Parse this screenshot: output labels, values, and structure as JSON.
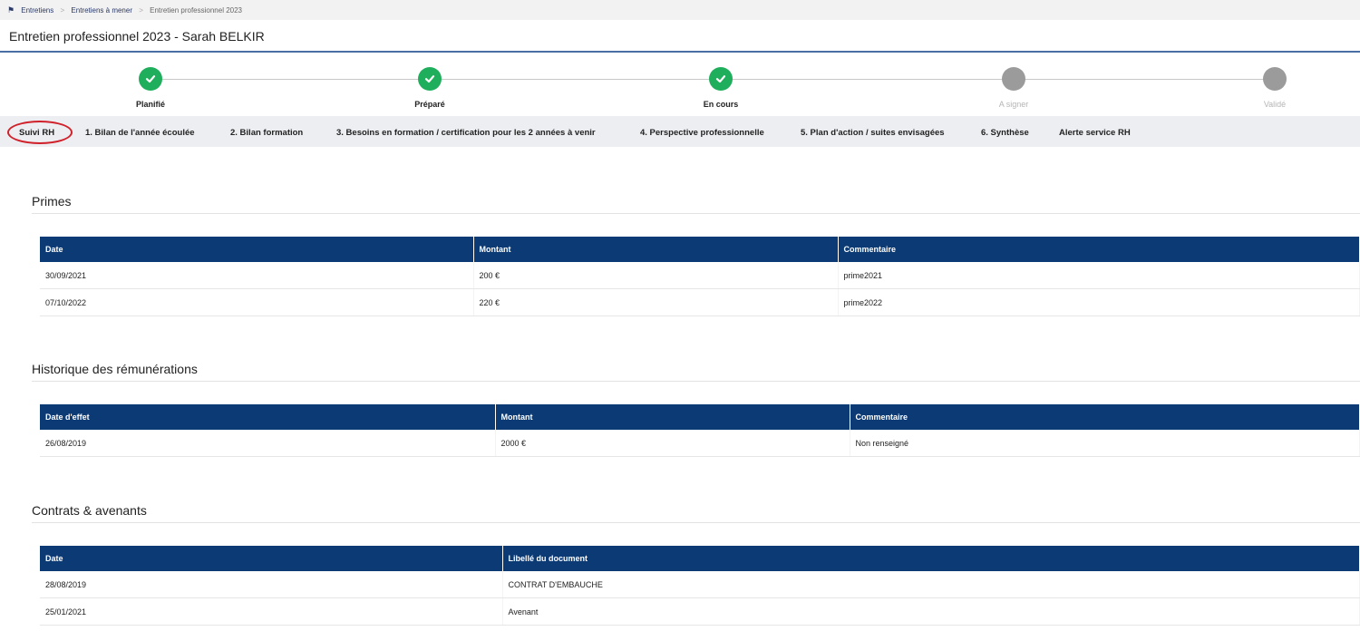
{
  "breadcrumb": {
    "items": [
      "Entretiens",
      "Entretiens à mener",
      "Entretien professionnel 2023"
    ]
  },
  "page_title": "Entretien professionnel 2023 - Sarah BELKIR",
  "stepper": {
    "steps": [
      {
        "label": "Planifié",
        "state": "done"
      },
      {
        "label": "Préparé",
        "state": "done"
      },
      {
        "label": "En cours",
        "state": "done"
      },
      {
        "label": "A signer",
        "state": "todo"
      },
      {
        "label": "Validé",
        "state": "todo"
      }
    ]
  },
  "tabs": [
    "Suivi RH",
    "1. Bilan de l'année écoulée",
    "2. Bilan formation",
    "3. Besoins en formation / certification pour les 2 années à venir",
    "4. Perspective professionnelle",
    "5. Plan d'action / suites envisagées",
    "6. Synthèse",
    "Alerte service RH"
  ],
  "primes": {
    "title": "Primes",
    "headers": [
      "Date",
      "Montant",
      "Commentaire"
    ],
    "rows": [
      [
        "30/09/2021",
        "200 €",
        "prime2021"
      ],
      [
        "07/10/2022",
        "220 €",
        "prime2022"
      ]
    ]
  },
  "remunerations": {
    "title": "Historique des rémunérations",
    "headers": [
      "Date d'effet",
      "Montant",
      "Commentaire"
    ],
    "rows": [
      [
        "26/08/2019",
        "2000 €",
        "Non renseigné"
      ]
    ]
  },
  "contrats": {
    "title": "Contrats & avenants",
    "headers": [
      "Date",
      "Libellé du document"
    ],
    "rows": [
      [
        "28/08/2019",
        "CONTRAT D'EMBAUCHE"
      ],
      [
        "25/01/2021",
        "Avenant"
      ]
    ]
  },
  "colors": {
    "header_blue": "#0c3a75",
    "step_done": "#1fae5c",
    "step_todo": "#9b9b9b",
    "active_tab_circle": "#d0202a"
  }
}
